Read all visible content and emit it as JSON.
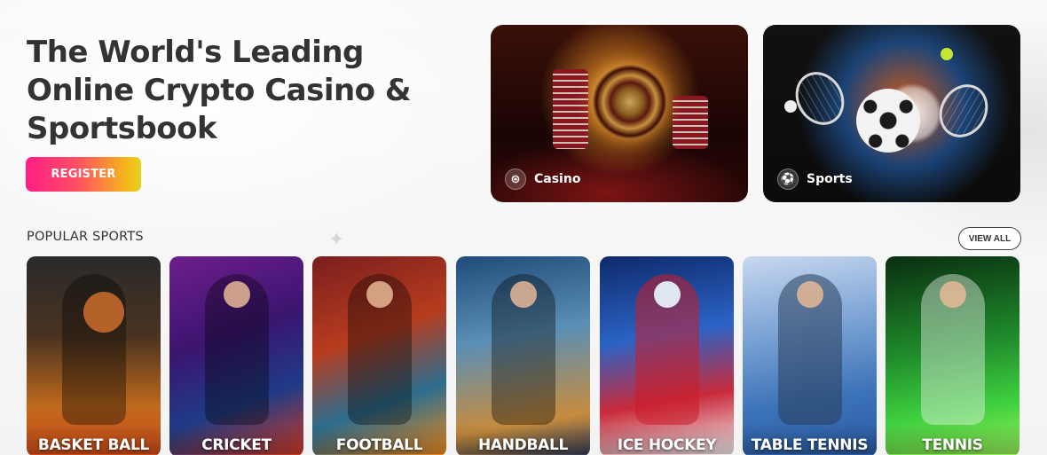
{
  "hero": {
    "title": "The World's Leading Online Crypto Casino & Sportsbook",
    "register_label": "REGISTER"
  },
  "feature_cards": [
    {
      "label": "Casino",
      "icon": "roulette-chip-icon"
    },
    {
      "label": "Sports",
      "icon": "soccer-ball-icon"
    }
  ],
  "popular_sports": {
    "title": "POPULAR SPORTS",
    "view_all_label": "VIEW ALL",
    "items": [
      {
        "label": "BASKET BALL"
      },
      {
        "label": "CRICKET"
      },
      {
        "label": "FOOTBALL"
      },
      {
        "label": "HANDBALL"
      },
      {
        "label": "ICE HOCKEY"
      },
      {
        "label": "TABLE TENNIS"
      },
      {
        "label": "TENNIS"
      }
    ]
  },
  "colors": {
    "register_gradient_start": "#ff1f86",
    "register_gradient_end": "#e8d11c",
    "heading": "#333333"
  }
}
